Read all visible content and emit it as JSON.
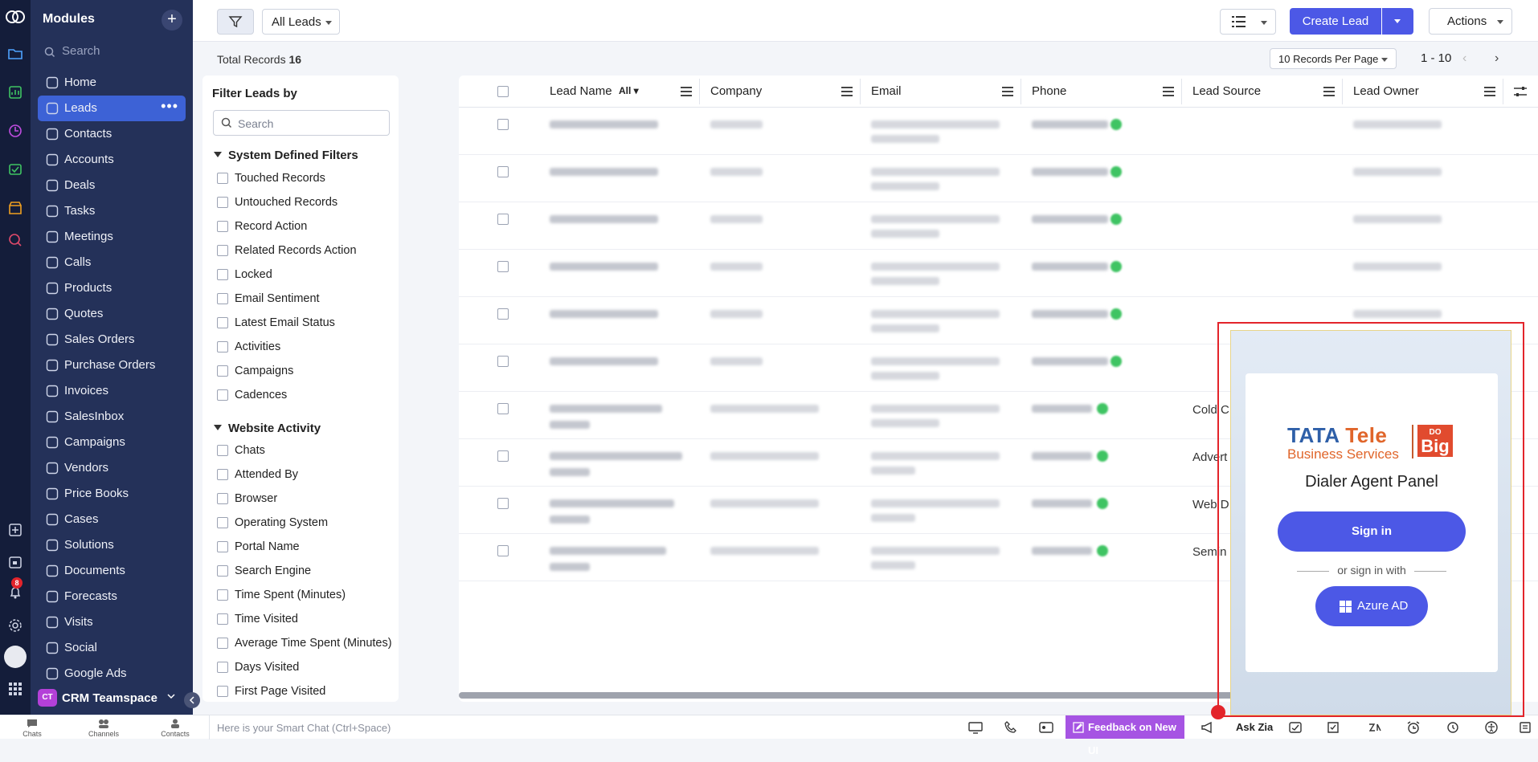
{
  "sidebar": {
    "title": "Modules",
    "search_placeholder": "Search",
    "items": [
      {
        "label": "Home",
        "icon": "home-icon"
      },
      {
        "label": "Leads",
        "icon": "leads-icon",
        "active": true
      },
      {
        "label": "Contacts",
        "icon": "contacts-icon"
      },
      {
        "label": "Accounts",
        "icon": "accounts-icon"
      },
      {
        "label": "Deals",
        "icon": "deals-icon"
      },
      {
        "label": "Tasks",
        "icon": "tasks-icon"
      },
      {
        "label": "Meetings",
        "icon": "meetings-icon"
      },
      {
        "label": "Calls",
        "icon": "calls-icon"
      },
      {
        "label": "Products",
        "icon": "products-icon"
      },
      {
        "label": "Quotes",
        "icon": "quotes-icon"
      },
      {
        "label": "Sales Orders",
        "icon": "sales-orders-icon"
      },
      {
        "label": "Purchase Orders",
        "icon": "purchase-orders-icon"
      },
      {
        "label": "Invoices",
        "icon": "invoices-icon"
      },
      {
        "label": "SalesInbox",
        "icon": "salesinbox-icon"
      },
      {
        "label": "Campaigns",
        "icon": "campaigns-icon"
      },
      {
        "label": "Vendors",
        "icon": "vendors-icon"
      },
      {
        "label": "Price Books",
        "icon": "price-books-icon"
      },
      {
        "label": "Cases",
        "icon": "cases-icon"
      },
      {
        "label": "Solutions",
        "icon": "solutions-icon"
      },
      {
        "label": "Documents",
        "icon": "documents-icon"
      },
      {
        "label": "Forecasts",
        "icon": "forecasts-icon"
      },
      {
        "label": "Visits",
        "icon": "visits-icon"
      },
      {
        "label": "Social",
        "icon": "social-icon"
      },
      {
        "label": "Google Ads",
        "icon": "google-ads-icon"
      }
    ],
    "team": {
      "badge": "CT",
      "name": "CRM Teamspace"
    }
  },
  "rail": {
    "notification_count": "8"
  },
  "toolbar": {
    "view_label": "All Leads",
    "create_label": "Create Lead",
    "actions_label": "Actions"
  },
  "records": {
    "total_label": "Total Records",
    "total": "16",
    "per_page": "10 Records Per Page",
    "range": "1 - 10"
  },
  "filters": {
    "title": "Filter Leads by",
    "search_placeholder": "Search",
    "system_group": "System Defined Filters",
    "system": [
      "Touched Records",
      "Untouched Records",
      "Record Action",
      "Related Records Action",
      "Locked",
      "Email Sentiment",
      "Latest Email Status",
      "Activities",
      "Campaigns",
      "Cadences"
    ],
    "website_group": "Website Activity",
    "website": [
      "Chats",
      "Attended By",
      "Browser",
      "Operating System",
      "Portal Name",
      "Search Engine",
      "Time Spent (Minutes)",
      "Time Visited",
      "Average Time Spent (Minutes)",
      "Days Visited",
      "First Page Visited"
    ]
  },
  "table": {
    "columns": [
      "Lead Name",
      "Company",
      "Email",
      "Phone",
      "Lead Source",
      "Lead Owner"
    ],
    "lead_name_filter": "All",
    "lead_sources": [
      "",
      "",
      "",
      "",
      "",
      "",
      "Cold C",
      "Advert",
      "Web D",
      "Semin"
    ]
  },
  "dialer": {
    "brand_line1a": "TATA ",
    "brand_line1b": "Tele",
    "brand_line2": "Business Services",
    "brand_badge_small": "DO",
    "brand_badge_big": "Big",
    "title": "Dialer Agent Panel",
    "signin_label": "Sign in",
    "or_label": "or sign in with",
    "azure_label": "Azure AD"
  },
  "bottombar": {
    "items": [
      "Chats",
      "Channels",
      "Contacts"
    ],
    "smart_chat_placeholder": "Here is your Smart Chat (Ctrl+Space)",
    "feedback_label": "Feedback on New UI",
    "ask_zia": "Ask Zia"
  },
  "colors": {
    "accent": "#4c58e6",
    "sidebar": "#243159",
    "active": "#3d62d6",
    "feedback": "#a654e3"
  }
}
